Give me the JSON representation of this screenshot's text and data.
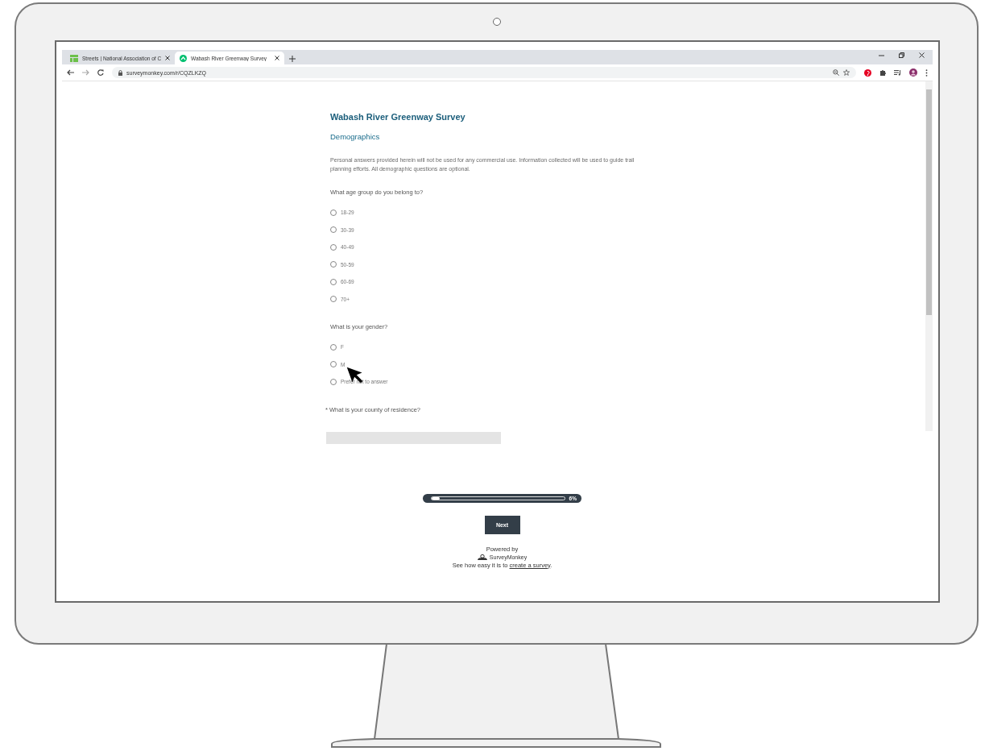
{
  "browser": {
    "tabs": [
      {
        "title": "Streets | National Association of C",
        "selected": false
      },
      {
        "title": "Wabash River Greenway Survey",
        "selected": true
      }
    ],
    "url": "surveymonkey.com/r/CQZLKZQ"
  },
  "survey": {
    "title": "Wabash River Greenway Survey",
    "page_title": "Demographics",
    "description": "Personal answers provided herein will not be used for any commercial use.  Information collected will be used to guide trail planning efforts. All demographic questions are optional.",
    "questions": [
      {
        "kind": "radio",
        "text": "What age group do you belong to?",
        "options": [
          {
            "label": "18-29",
            "selected": false
          },
          {
            "label": "30-39",
            "selected": false
          },
          {
            "label": "40-49",
            "selected": false
          },
          {
            "label": "50-59",
            "selected": false
          },
          {
            "label": "60-69",
            "selected": false
          },
          {
            "label": "70+",
            "selected": false
          }
        ]
      },
      {
        "kind": "radio",
        "text": "What is your gender?",
        "options": [
          {
            "label": "F",
            "selected": false
          },
          {
            "label": "M",
            "selected": false
          },
          {
            "label": "Prefer not to answer",
            "selected": false
          }
        ]
      },
      {
        "kind": "text",
        "marker": "*",
        "text": "What is your county of residence?"
      }
    ],
    "progress": {
      "level": 0.06,
      "reading": "6%"
    },
    "next_button": "Next",
    "footer": {
      "powered_by": "Powered by",
      "brand": "SurveyMonkey",
      "sentence": "See how easy it is to",
      "link": "create a survey",
      "end": "."
    }
  }
}
